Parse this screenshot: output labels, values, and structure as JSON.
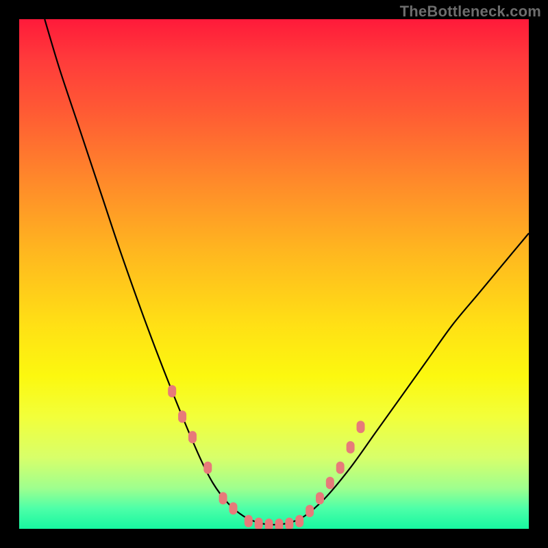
{
  "watermark": "TheBottleneck.com",
  "chart_data": {
    "type": "line",
    "title": "",
    "xlabel": "",
    "ylabel": "",
    "xlim": [
      0,
      100
    ],
    "ylim": [
      0,
      100
    ],
    "grid": false,
    "legend": false,
    "series": [
      {
        "name": "bottleneck-curve",
        "color": "#000000",
        "x": [
          5,
          8,
          12,
          16,
          20,
          25,
          30,
          35,
          38,
          41,
          44,
          47,
          50,
          53,
          56,
          60,
          65,
          70,
          75,
          80,
          85,
          90,
          95,
          100
        ],
        "y": [
          100,
          90,
          78,
          66,
          54,
          40,
          27,
          15,
          9,
          5,
          2.5,
          1.2,
          0.8,
          1.2,
          2.5,
          6,
          12,
          19,
          26,
          33,
          40,
          46,
          52,
          58
        ]
      },
      {
        "name": "data-points",
        "color": "#e77a7a",
        "style": "marker",
        "x": [
          30,
          32,
          34,
          37,
          40,
          42,
          45,
          47,
          49,
          51,
          53,
          55,
          57,
          59,
          61,
          63,
          65,
          67
        ],
        "y": [
          27,
          22,
          18,
          12,
          6,
          4,
          1.5,
          1,
          0.8,
          0.8,
          1,
          1.5,
          3.5,
          6,
          9,
          12,
          16,
          20
        ]
      }
    ],
    "background_gradient": {
      "top": "#ff1a3a",
      "bottom": "#17f7a0"
    }
  }
}
